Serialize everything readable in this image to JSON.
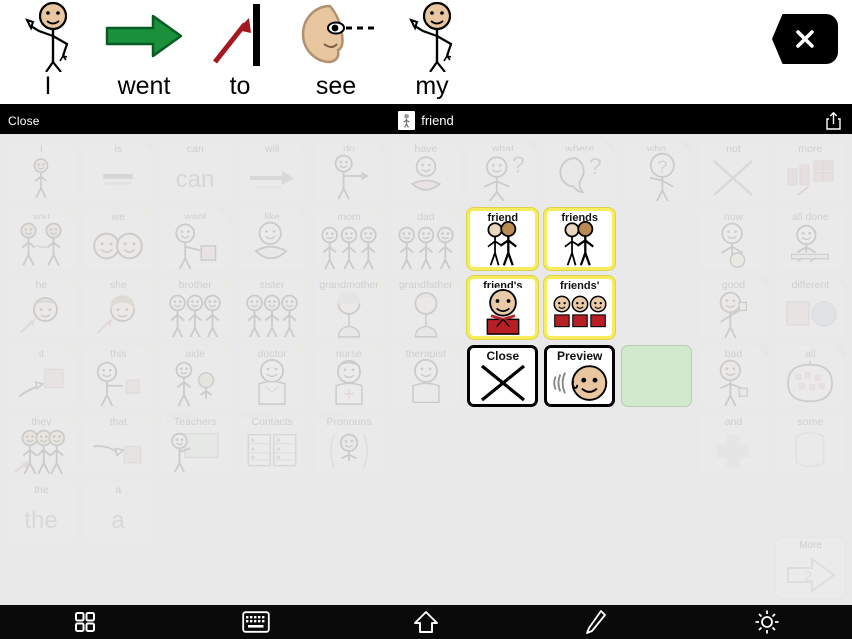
{
  "app": {
    "accent_yellow": "#f7ec5a",
    "green_cell": "#d3e9cd",
    "toolbar_bg": "#0a0a0a",
    "board_bg": "#e9e9e9"
  },
  "sentence_strip": {
    "words": [
      {
        "label": "I",
        "symbol": "person-pointing-self-icon"
      },
      {
        "label": "went",
        "symbol": "green-arrow-icon"
      },
      {
        "label": "to",
        "symbol": "red-arrow-to-bar-icon"
      },
      {
        "label": "see",
        "symbol": "face-eye-looking-icon"
      },
      {
        "label": "my",
        "symbol": "person-pointing-self-icon"
      }
    ],
    "clear_button": {
      "label": "",
      "icon": "clear-x-icon"
    }
  },
  "modal_header": {
    "close_label": "Close",
    "title": "friend",
    "thumb_icon": "friend-thumbnail-icon",
    "share_icon": "share-icon"
  },
  "board": {
    "rows": [
      [
        {
          "label": "I",
          "icon": "person-pointing-self-icon",
          "state": "dim",
          "corner": "pink"
        },
        {
          "label": "is",
          "icon": "equals-line-icon",
          "state": "dim",
          "corner": "pink"
        },
        {
          "label": "can",
          "icon": "text-can-icon",
          "state": "dim",
          "corner": "none"
        },
        {
          "label": "will",
          "icon": "arrow-right-icon",
          "state": "dim",
          "corner": "pink"
        },
        {
          "label": "do",
          "icon": "person-doing-icon",
          "state": "dim",
          "corner": "pink"
        },
        {
          "label": "have",
          "icon": "person-holding-icon",
          "state": "dim",
          "corner": "pink"
        },
        {
          "label": "what",
          "icon": "person-question-icon",
          "state": "dim",
          "corner": "blue"
        },
        {
          "label": "where",
          "icon": "place-question-icon",
          "state": "dim",
          "corner": "blue"
        },
        {
          "label": "who",
          "icon": "person-who-question-icon",
          "state": "dim",
          "corner": "blue"
        },
        {
          "label": "not",
          "icon": "big-x-icon",
          "state": "dim",
          "corner": "none"
        },
        {
          "label": "more",
          "icon": "more-blocks-icon",
          "state": "dim",
          "corner": "none"
        }
      ],
      [
        {
          "label": "you",
          "icon": "two-people-pointing-icon",
          "state": "dim",
          "corner": "yellow"
        },
        {
          "label": "we",
          "icon": "two-faces-icon",
          "state": "dim",
          "corner": "yellow"
        },
        {
          "label": "want",
          "icon": "person-wanting-icon",
          "state": "dim",
          "corner": "pink"
        },
        {
          "label": "like",
          "icon": "person-liking-icon",
          "state": "dim",
          "corner": "pink"
        },
        {
          "label": "mom",
          "icon": "mother-family-icon",
          "state": "dim",
          "corner": "yellow"
        },
        {
          "label": "dad",
          "icon": "father-family-icon",
          "state": "dim",
          "corner": "yellow"
        },
        {
          "label": "friend",
          "icon": "two-friends-standing-icon",
          "state": "highlight",
          "corner": "none"
        },
        {
          "label": "friends",
          "icon": "two-friends-standing-icon",
          "state": "highlight",
          "corner": "none"
        },
        {
          "label": "",
          "icon": "",
          "state": "empty",
          "corner": "none"
        },
        {
          "label": "now",
          "icon": "person-now-icon",
          "state": "dim",
          "corner": "none"
        },
        {
          "label": "all done",
          "icon": "all-done-icon",
          "state": "dim",
          "corner": "none"
        }
      ],
      [
        {
          "label": "he",
          "icon": "boy-face-arrow-icon",
          "state": "dim",
          "corner": "yellow"
        },
        {
          "label": "she",
          "icon": "girl-face-arrow-icon",
          "state": "dim",
          "corner": "yellow"
        },
        {
          "label": "brother",
          "icon": "brother-family-icon",
          "state": "dim",
          "corner": "yellow"
        },
        {
          "label": "sister",
          "icon": "sister-family-icon",
          "state": "dim",
          "corner": "yellow"
        },
        {
          "label": "grandmother",
          "icon": "grandmother-icon",
          "state": "dim",
          "corner": "yellow"
        },
        {
          "label": "grandfather",
          "icon": "grandfather-icon",
          "state": "dim",
          "corner": "yellow"
        },
        {
          "label": "friend's",
          "icon": "friend-gift-icon",
          "state": "highlight",
          "corner": "none"
        },
        {
          "label": "friends'",
          "icon": "three-friends-gift-icon",
          "state": "highlight",
          "corner": "none"
        },
        {
          "label": "",
          "icon": "",
          "state": "empty",
          "corner": "none"
        },
        {
          "label": "good",
          "icon": "thumbs-up-person-icon",
          "state": "dim",
          "corner": "blue"
        },
        {
          "label": "different",
          "icon": "square-circle-icon",
          "state": "dim",
          "corner": "blue"
        }
      ],
      [
        {
          "label": "it",
          "icon": "pointing-at-object-icon",
          "state": "dim",
          "corner": "yellow"
        },
        {
          "label": "this",
          "icon": "person-pointing-object-icon",
          "state": "dim",
          "corner": "yellow"
        },
        {
          "label": "aide",
          "icon": "aide-helper-icon",
          "state": "dim",
          "corner": "yellow"
        },
        {
          "label": "doctor",
          "icon": "doctor-icon",
          "state": "dim",
          "corner": "yellow"
        },
        {
          "label": "nurse",
          "icon": "nurse-icon",
          "state": "dim",
          "corner": "yellow"
        },
        {
          "label": "therapist",
          "icon": "therapist-icon",
          "state": "dim",
          "corner": "yellow"
        },
        {
          "label": "Close",
          "icon": "close-x-icon",
          "state": "action",
          "corner": "none"
        },
        {
          "label": "Preview",
          "icon": "speaking-face-icon",
          "state": "action",
          "corner": "none"
        },
        {
          "label": "",
          "icon": "",
          "state": "green",
          "corner": "none"
        },
        {
          "label": "bad",
          "icon": "thumbs-down-person-icon",
          "state": "dim",
          "corner": "blue"
        },
        {
          "label": "all",
          "icon": "all-group-icon",
          "state": "dim",
          "corner": "blue"
        }
      ],
      [
        {
          "label": "they",
          "icon": "group-people-arrow-icon",
          "state": "dim",
          "corner": "yellow"
        },
        {
          "label": "that",
          "icon": "pointing-that-icon",
          "state": "dim",
          "corner": "yellow"
        },
        {
          "label": "Teachers",
          "icon": "teacher-folder-icon",
          "state": "folder",
          "corner": "none"
        },
        {
          "label": "Contacts",
          "icon": "contacts-folder-icon",
          "state": "folder",
          "corner": "none"
        },
        {
          "label": "Pronouns",
          "icon": "pronouns-folder-icon",
          "state": "folder",
          "corner": "none"
        },
        {
          "label": "",
          "icon": "",
          "state": "empty",
          "corner": "none"
        },
        {
          "label": "",
          "icon": "",
          "state": "empty",
          "corner": "none"
        },
        {
          "label": "",
          "icon": "",
          "state": "empty",
          "corner": "none"
        },
        {
          "label": "",
          "icon": "",
          "state": "empty",
          "corner": "none"
        },
        {
          "label": "and",
          "icon": "plus-cross-icon",
          "state": "dim",
          "corner": "none"
        },
        {
          "label": "some",
          "icon": "cylinder-icon",
          "state": "dim",
          "corner": "none"
        }
      ],
      [
        {
          "label": "the",
          "icon": "text-the-icon",
          "state": "dim",
          "corner": "none"
        },
        {
          "label": "a",
          "icon": "text-a-icon",
          "state": "dim",
          "corner": "none"
        },
        {
          "label": "",
          "icon": "",
          "state": "empty",
          "corner": "none"
        },
        {
          "label": "",
          "icon": "",
          "state": "empty",
          "corner": "none"
        },
        {
          "label": "",
          "icon": "",
          "state": "empty",
          "corner": "none"
        },
        {
          "label": "",
          "icon": "",
          "state": "empty",
          "corner": "none"
        },
        {
          "label": "",
          "icon": "",
          "state": "empty",
          "corner": "none"
        },
        {
          "label": "",
          "icon": "",
          "state": "empty",
          "corner": "none"
        },
        {
          "label": "",
          "icon": "",
          "state": "empty",
          "corner": "none"
        },
        {
          "label": "",
          "icon": "",
          "state": "empty",
          "corner": "none"
        },
        {
          "label": "",
          "icon": "",
          "state": "empty",
          "corner": "none"
        }
      ]
    ],
    "more_button": {
      "label": "More",
      "page_number": "2",
      "icon": "more-arrow-icon"
    }
  },
  "toolbar": {
    "items": [
      {
        "name": "grid-view-button",
        "icon": "grid-icon"
      },
      {
        "name": "keyboard-button",
        "icon": "keyboard-icon"
      },
      {
        "name": "home-button",
        "icon": "home-icon"
      },
      {
        "name": "edit-button",
        "icon": "pencil-icon"
      },
      {
        "name": "settings-button",
        "icon": "gear-icon"
      }
    ]
  }
}
